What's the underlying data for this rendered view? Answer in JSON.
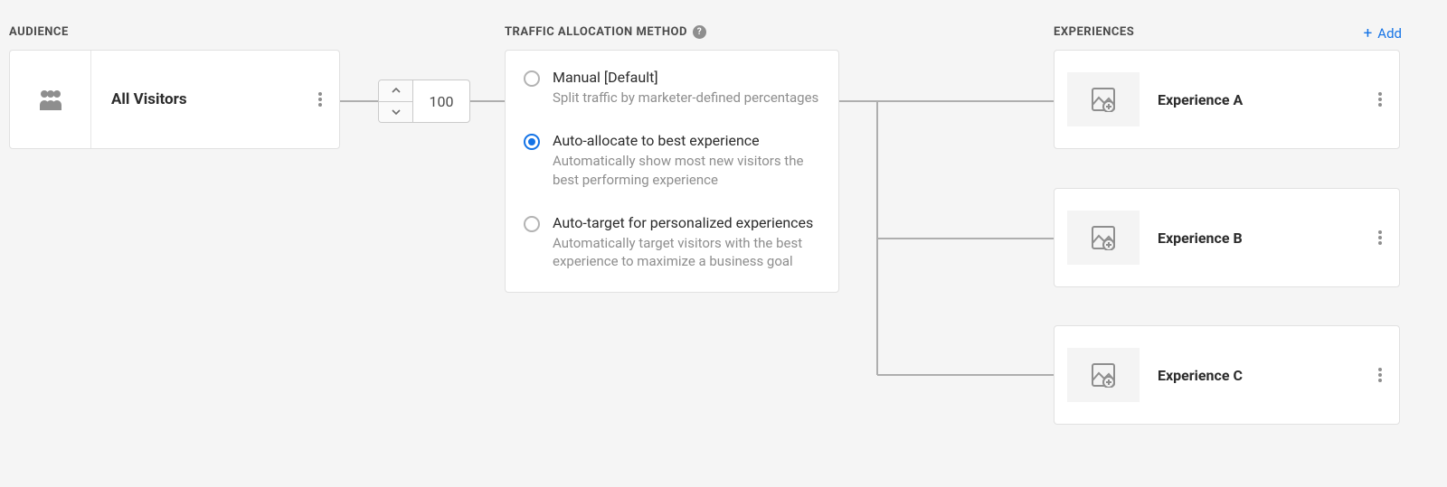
{
  "sections": {
    "audience_label": "AUDIENCE",
    "traffic_label": "TRAFFIC ALLOCATION METHOD",
    "experiences_label": "EXPERIENCES"
  },
  "audience": {
    "name": "All Visitors"
  },
  "stepper": {
    "value": "100"
  },
  "traffic_options": {
    "manual": {
      "title": "Manual [Default]",
      "desc": "Split traffic by marketer-defined percentages",
      "selected": false
    },
    "auto_allocate": {
      "title": "Auto-allocate to best experience",
      "desc": "Automatically show most new visitors the best performing experience",
      "selected": true
    },
    "auto_target": {
      "title": "Auto-target for personalized experiences",
      "desc": "Automatically target visitors with the best experience to maximize a business goal",
      "selected": false
    }
  },
  "add_label": "Add",
  "experiences": {
    "a": "Experience A",
    "b": "Experience B",
    "c": "Experience C"
  }
}
